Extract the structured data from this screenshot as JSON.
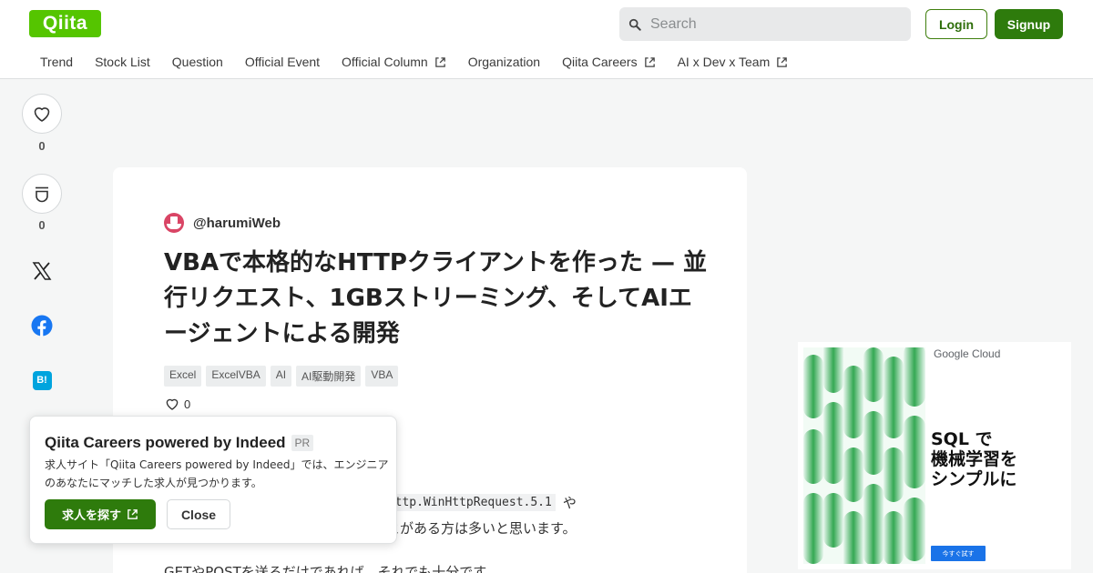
{
  "header": {
    "logo": "Qiita",
    "search_placeholder": "Search",
    "login_label": "Login",
    "signup_label": "Signup"
  },
  "nav": {
    "items": [
      {
        "label": "Trend",
        "external": false
      },
      {
        "label": "Stock List",
        "external": false
      },
      {
        "label": "Question",
        "external": false
      },
      {
        "label": "Official Event",
        "external": false
      },
      {
        "label": "Official Column",
        "external": true
      },
      {
        "label": "Organization",
        "external": false
      },
      {
        "label": "Qiita Careers",
        "external": true
      },
      {
        "label": "AI x Dev x Team",
        "external": true
      }
    ]
  },
  "rail": {
    "like_count": "0",
    "stock_count": "0",
    "hatena_label": "B!"
  },
  "article": {
    "author": "@harumiWeb",
    "title": "VBAで本格的なHTTPクライアントを作った — 並行リクエスト、1GBストリーミング、そしてAIエージェントによる開発",
    "tags": [
      "Excel",
      "ExcelVBA",
      "AI",
      "AI駆動開発",
      "VBA"
    ],
    "likes": "0",
    "body_code": "nHttp.WinHttpRequest.5.1",
    "body_line1_suffix": "や",
    "body_line2": "とがある方は多いと思います。",
    "body_line3": "GETやPOSTを送るだけであれば、それでも十分です。"
  },
  "popup": {
    "title": "Qiita Careers powered by Indeed",
    "pr_badge": "PR",
    "text": "求人サイト「Qiita Careers powered by Indeed」では、エンジニアのあなたにマッチした求人が見つかります。",
    "find_label": "求人を探す",
    "close_label": "Close"
  },
  "ad": {
    "brand_word1": "Google",
    "brand_word2": " Cloud",
    "headline": "SQL で\n機械学習を\nシンプルに",
    "cta": "今すぐ試す"
  },
  "colors": {
    "brand_green": "#55c500",
    "button_green": "#2e7b0c",
    "background": "#f5f6f6"
  }
}
